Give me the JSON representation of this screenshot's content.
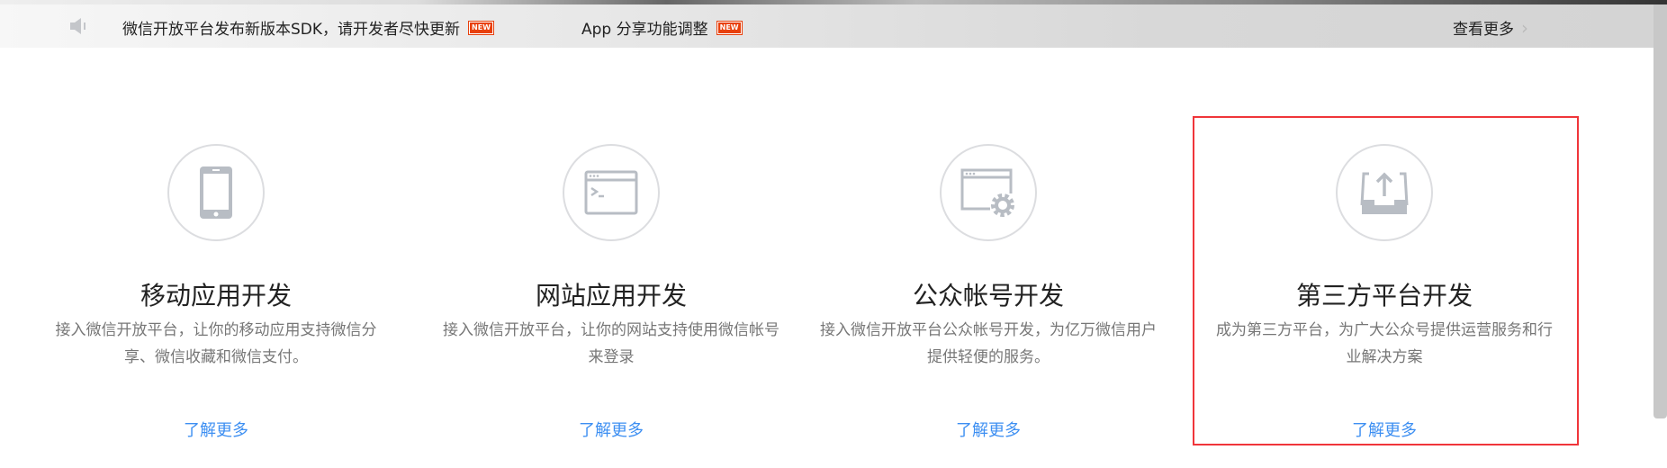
{
  "notice_bar": {
    "items": [
      {
        "text": "微信开放平台发布新版本SDK，请开发者尽快更新",
        "badge": "NEW"
      },
      {
        "text": "App 分享功能调整",
        "badge": "NEW"
      }
    ],
    "more_label": "查看更多"
  },
  "features": [
    {
      "icon": "mobile-phone-icon",
      "title": "移动应用开发",
      "desc": "接入微信开放平台，让你的移动应用支持微信分享、微信收藏和微信支付。",
      "link": "了解更多"
    },
    {
      "icon": "browser-terminal-icon",
      "title": "网站应用开发",
      "desc": "接入微信开放平台，让你的网站支持使用微信帐号来登录",
      "link": "了解更多"
    },
    {
      "icon": "browser-gear-icon",
      "title": "公众帐号开发",
      "desc": "接入微信开放平台公众帐号开发，为亿万微信用户提供轻便的服务。",
      "link": "了解更多"
    },
    {
      "icon": "inbox-upload-icon",
      "title": "第三方平台开发",
      "desc": "成为第三方平台，为广大公众号提供运营服务和行业解决方案",
      "link": "了解更多"
    }
  ],
  "colors": {
    "link": "#3d8ff2",
    "highlight": "#f0353a",
    "badge": "#e8400c"
  }
}
